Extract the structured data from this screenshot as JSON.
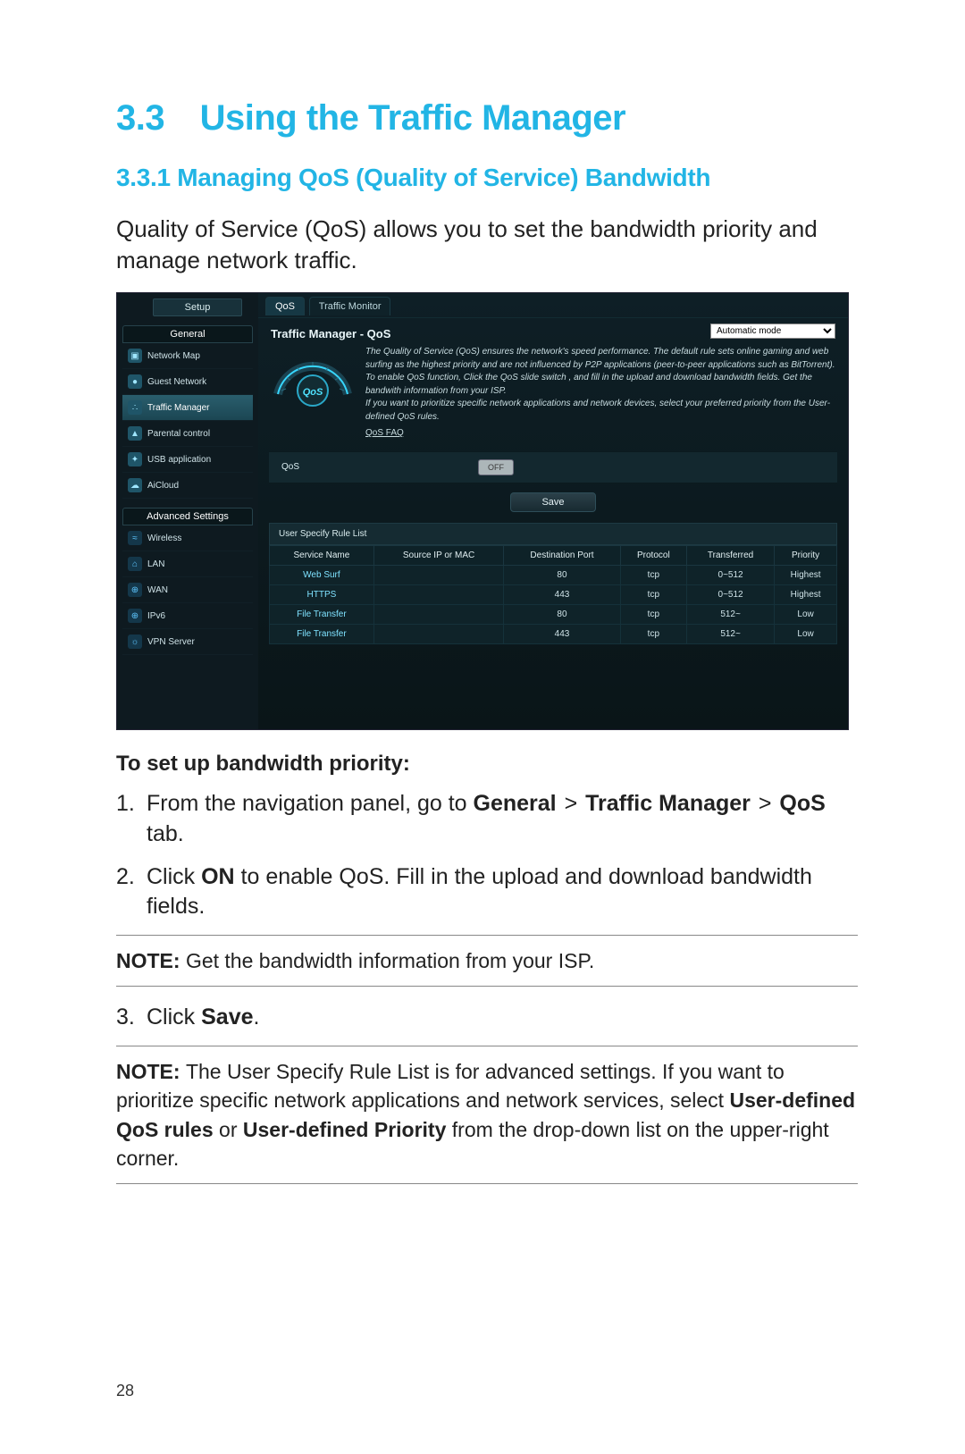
{
  "page_number": "28",
  "section": {
    "number_title": "3.3 Using the Traffic Manager",
    "sub_title": "3.3.1 Managing QoS (Quality of Service) Bandwidth",
    "intro": "Quality of Service (QoS) allows you to set the bandwidth priority and manage network traffic."
  },
  "instructions": {
    "heading": "To set up bandwidth priority:",
    "step1_pre": "From the navigation panel, go to ",
    "step1_b1": "General",
    "step1_sep": " > ",
    "step1_b2": "Traffic Manager",
    "step1_b3": "QoS",
    "step1_post": " tab.",
    "step2_pre": "Click ",
    "step2_b": "ON",
    "step2_post": " to enable QoS. Fill in the upload and download bandwidth fields.",
    "step3_pre": "Click ",
    "step3_b": "Save",
    "step3_post": "."
  },
  "note1_label": "NOTE:",
  "note1_text": " Get the bandwidth information from your ISP.",
  "note2_label": "NOTE:  ",
  "note2_text_a": " The User Specify Rule List is for advanced settings. If you want to prioritize specific network applications and network services, select ",
  "note2_b1": "User-defined QoS rules",
  "note2_or": " or ",
  "note2_b2": "User-defined Priority",
  "note2_text_b": " from the drop-down list on the upper-right corner.",
  "router": {
    "setup_btn": "Setup",
    "group_general": "General",
    "group_advanced": "Advanced Settings",
    "nav_general": [
      {
        "icon": "▣",
        "label": "Network Map"
      },
      {
        "icon": "●",
        "label": "Guest Network"
      },
      {
        "icon": "∴",
        "label": "Traffic Manager",
        "active": true
      },
      {
        "icon": "▲",
        "label": "Parental control"
      },
      {
        "icon": "✦",
        "label": "USB application"
      },
      {
        "icon": "☁",
        "label": "AiCloud"
      }
    ],
    "nav_advanced": [
      {
        "icon": "≈",
        "label": "Wireless"
      },
      {
        "icon": "⌂",
        "label": "LAN"
      },
      {
        "icon": "⊕",
        "label": "WAN"
      },
      {
        "icon": "⊕",
        "label": "IPv6"
      },
      {
        "icon": "☼",
        "label": "VPN Server"
      }
    ],
    "tabs": {
      "qos": "QoS",
      "monitor": "Traffic Monitor"
    },
    "panel_title": "Traffic Manager - QoS",
    "mode_option": "Automatic mode",
    "gauge_label": "QoS",
    "desc_1": "The Quality of Service (QoS) ensures the network's speed performance. The default rule sets online gaming and web surfing as the highest priority and are not influenced by P2P applications (peer-to-peer applications such as BitTorrent). To enable QoS function, Click the QoS slide switch , and fill in the upload and download bandwidth fields. Get the bandwith information from your ISP.",
    "desc_2": "If you want to prioritize specific network applications and network devices, select your preferred priority from the User-defined QoS rules.",
    "faq": "QoS FAQ",
    "row_label": "QoS",
    "toggle_state": "OFF",
    "save_btn": "Save",
    "rule_list_title": "User Specify Rule List",
    "columns": [
      "Service Name",
      "Source IP or MAC",
      "Destination Port",
      "Protocol",
      "Transferred",
      "Priority"
    ],
    "rows": [
      {
        "svc": "Web Surf",
        "src": "",
        "port": "80",
        "proto": "tcp",
        "trans": "0~512",
        "prio": "Highest"
      },
      {
        "svc": "HTTPS",
        "src": "",
        "port": "443",
        "proto": "tcp",
        "trans": "0~512",
        "prio": "Highest"
      },
      {
        "svc": "File Transfer",
        "src": "",
        "port": "80",
        "proto": "tcp",
        "trans": "512~",
        "prio": "Low"
      },
      {
        "svc": "File Transfer",
        "src": "",
        "port": "443",
        "proto": "tcp",
        "trans": "512~",
        "prio": "Low"
      }
    ]
  }
}
